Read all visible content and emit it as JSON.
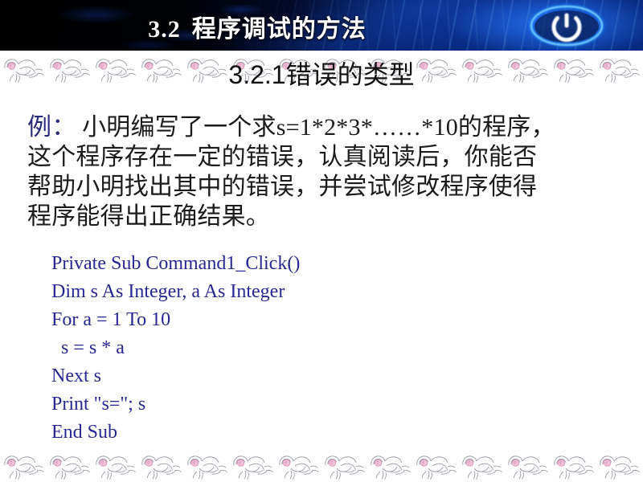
{
  "slide": {
    "banner": {
      "section_number": "3.2",
      "title": "程序调试的方法",
      "icon_name": "power-button-icon"
    },
    "subtitle": "3.2.1错误的类型",
    "decoration": {
      "rose_icon_name": "rose-icon",
      "top_rose_count": 14,
      "bottom_rose_count": 14
    },
    "body": {
      "lead_label": "例：",
      "lines": [
        "小明编写了一个求s=1*2*3*……*10的程序，",
        "这个程序存在一定的错误，认真阅读后，你能否",
        "帮助小明找出其中的错误，并尝试修改程序使得",
        "程序能得出正确结果。"
      ]
    },
    "code": {
      "lines": [
        "Private Sub Command1_Click()",
        "Dim s As Integer, a As Integer",
        "For a = 1 To 10",
        "  s = s * a",
        "Next s",
        "Print \"s=\"; s",
        "End Sub"
      ]
    },
    "colors": {
      "banner_blue": "#0A3C9C",
      "code_blue": "#272792",
      "lead_navy": "#2A2A7A",
      "rose_pink": "#E79FC0",
      "rose_outline": "#8A8A96",
      "title_white": "#FFFFFF"
    }
  }
}
